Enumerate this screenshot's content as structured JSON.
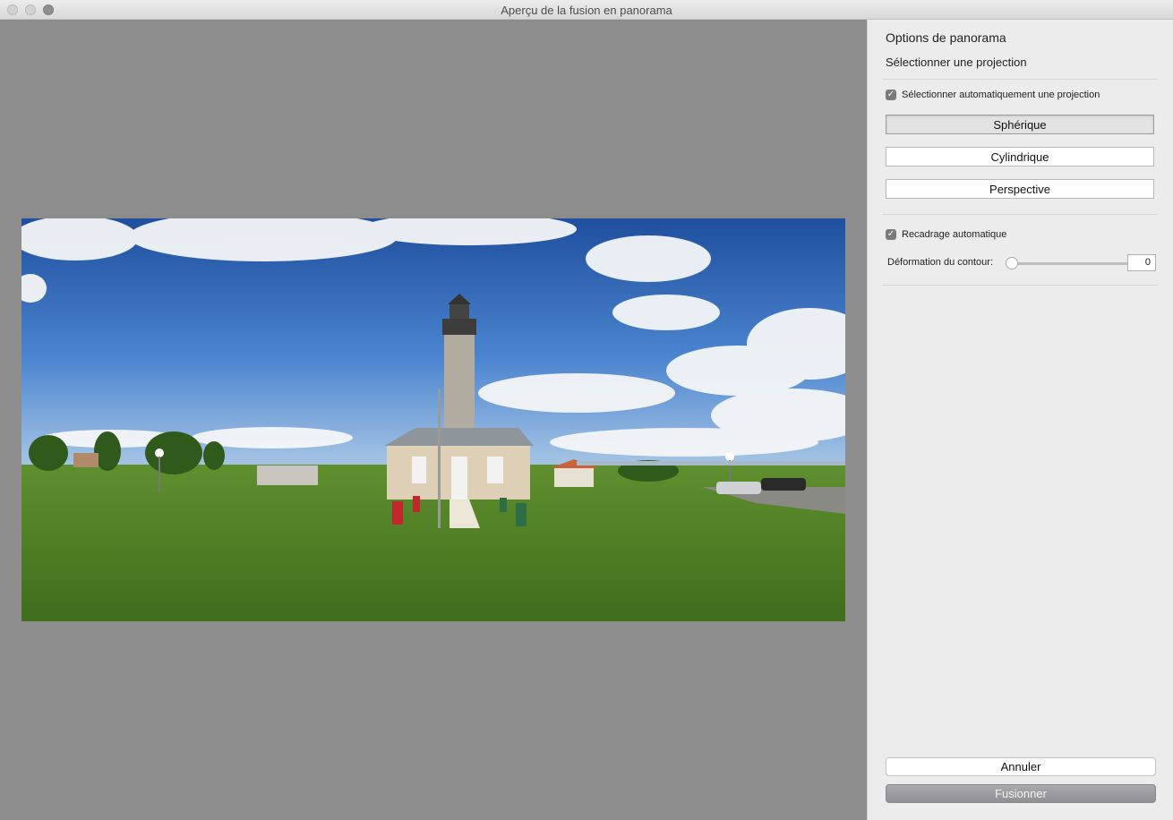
{
  "window": {
    "title": "Aperçu de la fusion en panorama"
  },
  "sidebar": {
    "title": "Options de panorama",
    "subtitle": "Sélectionner une projection",
    "auto_projection": {
      "label": "Sélectionner automatiquement une projection",
      "checked": true
    },
    "projections": [
      {
        "label": "Sphérique",
        "selected": true
      },
      {
        "label": "Cylindrique",
        "selected": false
      },
      {
        "label": "Perspective",
        "selected": false
      }
    ],
    "auto_crop": {
      "label": "Recadrage automatique",
      "checked": true
    },
    "boundary_warp": {
      "label": "Déformation du contour:",
      "value": "0"
    },
    "buttons": {
      "cancel": "Annuler",
      "merge": "Fusionner"
    }
  },
  "colors": {
    "accent_gray": "#8f8f95",
    "background": "#8c8c8c",
    "panel": "#ececec"
  },
  "icons": {
    "checkbox": "checkmark-icon"
  }
}
